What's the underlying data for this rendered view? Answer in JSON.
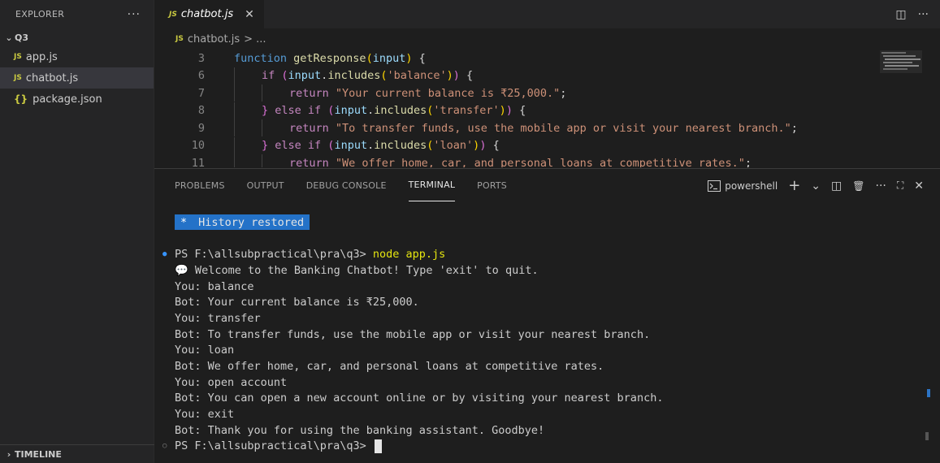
{
  "sidebar": {
    "header": "EXPLORER",
    "more": "···",
    "folder": "Q3",
    "files": [
      {
        "icon": "JS",
        "name": "app.js",
        "active": false
      },
      {
        "icon": "JS",
        "name": "chatbot.js",
        "active": true
      },
      {
        "icon": "{}",
        "name": "package.json",
        "active": false
      }
    ],
    "timeline": "TIMELINE"
  },
  "tabbar": {
    "tab": {
      "icon": "JS",
      "name": "chatbot.js",
      "close": "✕"
    },
    "split": "◫",
    "more": "···"
  },
  "breadcrumb": {
    "icon": "JS",
    "file": "chatbot.js",
    "rest": "> ..."
  },
  "editor": {
    "lines": [
      {
        "num": "3",
        "tokens": [
          [
            "kwb",
            "function "
          ],
          [
            "fn",
            "getResponse"
          ],
          [
            "pn",
            "("
          ],
          [
            "var",
            "input"
          ],
          [
            "pn",
            ")"
          ],
          [
            "tx",
            " {"
          ]
        ],
        "indent": 0
      },
      {
        "num": "6",
        "tokens": [
          [
            "kw",
            "if "
          ],
          [
            "pp",
            "("
          ],
          [
            "var",
            "input"
          ],
          [
            "tx",
            "."
          ],
          [
            "fn",
            "includes"
          ],
          [
            "pn",
            "("
          ],
          [
            "str",
            "'balance'"
          ],
          [
            "pn",
            ")"
          ],
          [
            "pp",
            ")"
          ],
          [
            "tx",
            " {"
          ]
        ],
        "indent": 1
      },
      {
        "num": "7",
        "tokens": [
          [
            "kw",
            "return "
          ],
          [
            "str",
            "\"Your current balance is ₹25,000.\""
          ],
          [
            "tx",
            ";"
          ]
        ],
        "indent": 2
      },
      {
        "num": "8",
        "tokens": [
          [
            "pp",
            "} "
          ],
          [
            "kw",
            "else if "
          ],
          [
            "pp",
            "("
          ],
          [
            "var",
            "input"
          ],
          [
            "tx",
            "."
          ],
          [
            "fn",
            "includes"
          ],
          [
            "pn",
            "("
          ],
          [
            "str",
            "'transfer'"
          ],
          [
            "pn",
            ")"
          ],
          [
            "pp",
            ")"
          ],
          [
            "tx",
            " {"
          ]
        ],
        "indent": 1
      },
      {
        "num": "9",
        "tokens": [
          [
            "kw",
            "return "
          ],
          [
            "str",
            "\"To transfer funds, use the mobile app or visit your nearest branch.\""
          ],
          [
            "tx",
            ";"
          ]
        ],
        "indent": 2
      },
      {
        "num": "10",
        "tokens": [
          [
            "pp",
            "} "
          ],
          [
            "kw",
            "else if "
          ],
          [
            "pp",
            "("
          ],
          [
            "var",
            "input"
          ],
          [
            "tx",
            "."
          ],
          [
            "fn",
            "includes"
          ],
          [
            "pn",
            "("
          ],
          [
            "str",
            "'loan'"
          ],
          [
            "pn",
            ")"
          ],
          [
            "pp",
            ")"
          ],
          [
            "tx",
            " {"
          ]
        ],
        "indent": 1
      },
      {
        "num": "11",
        "tokens": [
          [
            "kw",
            "return "
          ],
          [
            "str",
            "\"We offer home, car, and personal loans at competitive rates.\""
          ],
          [
            "tx",
            ";"
          ]
        ],
        "indent": 2
      }
    ]
  },
  "panel": {
    "tabs": [
      {
        "label": "PROBLEMS",
        "active": false
      },
      {
        "label": "OUTPUT",
        "active": false
      },
      {
        "label": "DEBUG CONSOLE",
        "active": false
      },
      {
        "label": "TERMINAL",
        "active": true
      },
      {
        "label": "PORTS",
        "active": false
      }
    ],
    "shell": "powershell",
    "new_terminal": "+",
    "dropdown": "⌄",
    "split": "◫",
    "trash": "🗑",
    "more": "···",
    "maximize": "⛶",
    "close": "✕"
  },
  "terminal": {
    "history_star": "*",
    "history_text": "History restored",
    "prompt1": "PS F:\\allsubpractical\\pra\\q3> ",
    "command": "node app.js",
    "output": [
      "💬 Welcome to the Banking Chatbot! Type 'exit' to quit.",
      "You: balance",
      "Bot: Your current balance is ₹25,000.",
      "You: transfer",
      "Bot: To transfer funds, use the mobile app or visit your nearest branch.",
      "You: loan",
      "Bot: We offer home, car, and personal loans at competitive rates.",
      "You: open account",
      "Bot: You can open a new account online or by visiting your nearest branch.",
      "You: exit",
      "Bot: Thank you for using the banking assistant. Goodbye!"
    ],
    "prompt2": "PS F:\\allsubpractical\\pra\\q3> "
  }
}
